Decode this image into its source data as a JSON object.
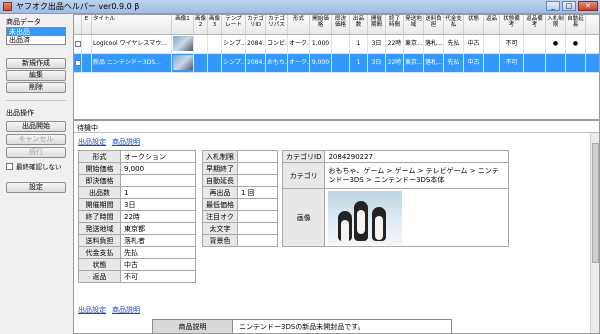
{
  "window": {
    "title": "ヤフオク出品ヘルパー ver0.9.0 β",
    "buttons": [
      "_",
      "□",
      "✕"
    ]
  },
  "left": {
    "product_data_label": "商品データ",
    "list_items": [
      "未出品",
      "出品済"
    ],
    "new_button": "新規作成",
    "edit_button": "編集",
    "delete_button": "削除",
    "listing_ops_label": "出品操作",
    "start_button": "出品開始",
    "cancel_button": "キャンセル",
    "resume_button": "続行",
    "final_check_label": "最終確認しない",
    "settings_button": "設定"
  },
  "grid": {
    "headers": [
      "E",
      "タイトル",
      "画像1",
      "画像2",
      "画像3",
      "テンプレート",
      "カテゴリID",
      "カテゴリパス",
      "形式",
      "開始価格",
      "即決価格",
      "出品数",
      "開催期間",
      "終了時間",
      "発送地域",
      "送料負担",
      "代金支払",
      "状態",
      "返品",
      "状態備考",
      "返品備考",
      "入札制限",
      "自動延長"
    ],
    "rows": [
      [
        "",
        "Logicool ワイヤレスマウ...",
        "",
        "",
        "",
        "シンプ...",
        "2084...",
        "コンピ...",
        "オーク...",
        "1,000",
        "",
        "1",
        "3日",
        "22時",
        "東京...",
        "落札...",
        "先払",
        "中古",
        "",
        "不可",
        "",
        "●",
        "●"
      ],
      [
        "",
        "新品 ニンテンドー3DS...",
        "",
        "",
        "",
        "シンプ...",
        "2084...",
        "おもち...",
        "オーク...",
        "9,000",
        "",
        "1",
        "3日",
        "22時",
        "東京...",
        "落札...",
        "先払",
        "中古",
        "",
        "不可",
        "",
        "",
        ""
      ]
    ]
  },
  "detail": {
    "status": "待機中",
    "link_settings": "出品設定",
    "link_description": "商品説明",
    "left_table": [
      [
        "形式",
        "オークション"
      ],
      [
        "開始価格",
        "9,000"
      ],
      [
        "即決価格",
        ""
      ],
      [
        "出品数",
        "1"
      ],
      [
        "開催期間",
        "3日"
      ],
      [
        "終了時間",
        "22時"
      ],
      [
        "発送地域",
        "東京都"
      ],
      [
        "送料負担",
        "落札者"
      ],
      [
        "代金支払",
        "先払"
      ],
      [
        "状態",
        "中古"
      ],
      [
        "返品",
        "不可"
      ]
    ],
    "mid_table": [
      [
        "入札制限",
        ""
      ],
      [
        "早期終了",
        ""
      ],
      [
        "自動延長",
        ""
      ],
      [
        "再出品",
        "1 回"
      ],
      [
        "最低価格",
        ""
      ],
      [
        "注目オク",
        ""
      ],
      [
        "太文字",
        ""
      ],
      [
        "背景色",
        ""
      ]
    ],
    "category_id_label": "カテゴリID",
    "category_id": "2084290227",
    "category_label": "カテゴリ",
    "category_path": "おもちゃ、ゲーム > ゲーム > テレビゲーム > ニンテンドー3DS > ニンテンドー3DS本体",
    "image_label": "画像",
    "desc_label": "商品説明",
    "desc_text": "ニンテンドー3DSの新品未開封品です。"
  }
}
